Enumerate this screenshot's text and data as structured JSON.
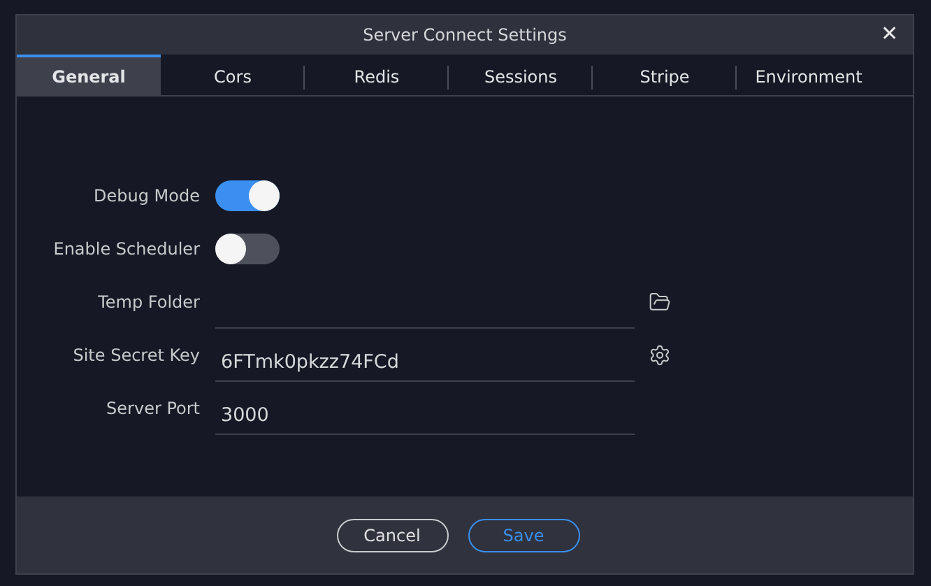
{
  "window": {
    "title": "Server Connect Settings",
    "close": "✕"
  },
  "tabs": [
    {
      "label": "General",
      "selected": true
    },
    {
      "label": "Cors",
      "selected": false
    },
    {
      "label": "Redis",
      "selected": false
    },
    {
      "label": "Sessions",
      "selected": false
    },
    {
      "label": "Stripe",
      "selected": false
    },
    {
      "label": "Environment",
      "selected": false
    }
  ],
  "fields": [
    {
      "kind": "toggle",
      "label": "Debug Mode",
      "on": true
    },
    {
      "kind": "toggle",
      "label": "Enable Scheduler",
      "on": false
    },
    {
      "kind": "folder",
      "label": "Temp Folder"
    },
    {
      "kind": "secret",
      "label": "Site Secret Key",
      "value": "6FTmk0pkzz74FCd"
    },
    {
      "kind": "text",
      "label": "Server Port",
      "value": "3000"
    }
  ],
  "buttons": [
    {
      "label": "Cancel",
      "primary": false
    },
    {
      "label": "Save",
      "primary": true
    }
  ]
}
